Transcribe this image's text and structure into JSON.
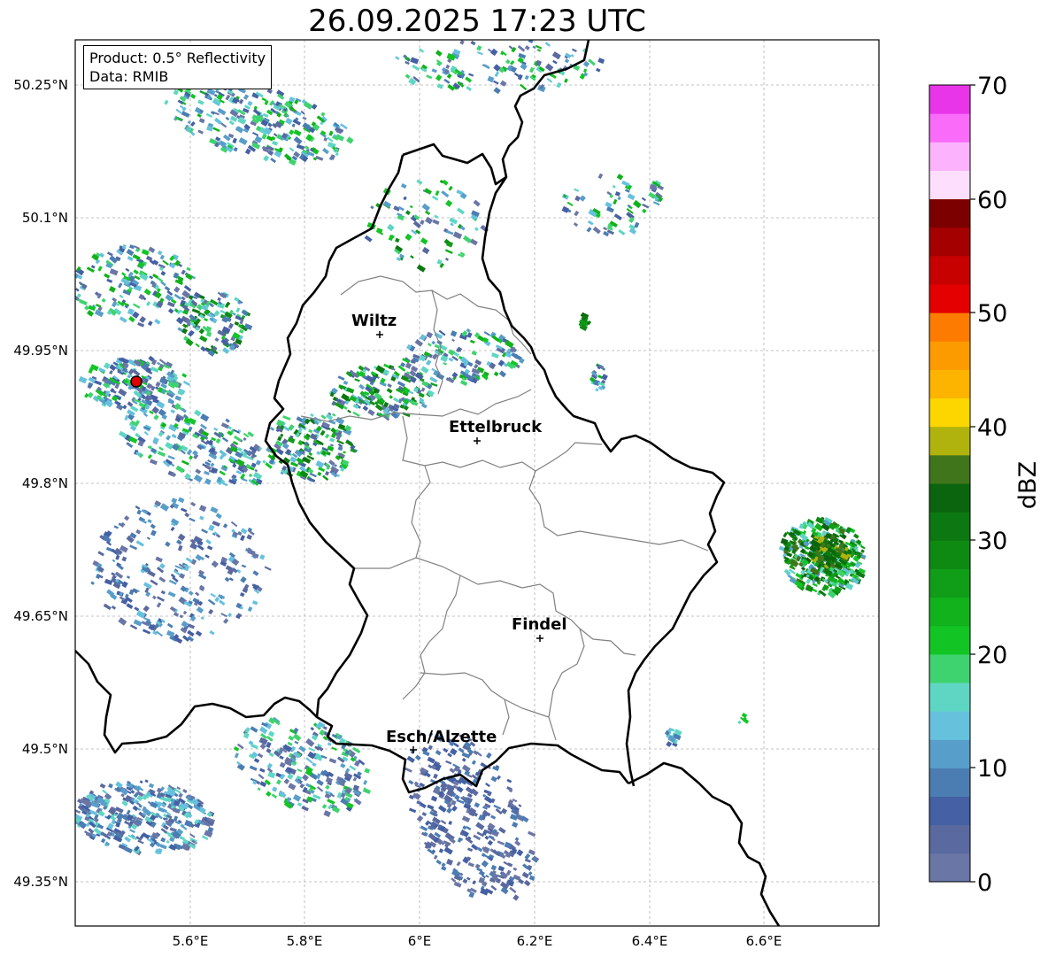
{
  "title": "26.09.2025 17:23 UTC",
  "info": {
    "product": "Product: 0.5° Reflectivity",
    "data": "Data: RMIB"
  },
  "axes": {
    "lon_ticks": [
      "5.6°E",
      "5.8°E",
      "6°E",
      "6.2°E",
      "6.4°E",
      "6.6°E"
    ],
    "lat_ticks": [
      "50.25°N",
      "50.1°N",
      "49.95°N",
      "49.8°N",
      "49.65°N",
      "49.5°N",
      "49.35°N"
    ]
  },
  "places": [
    {
      "name": "Wiltz"
    },
    {
      "name": "Ettelbruck"
    },
    {
      "name": "Findel"
    },
    {
      "name": "Esch/Alzette"
    }
  ],
  "colorbar": {
    "label": "dBZ",
    "ticks": [
      "0",
      "10",
      "20",
      "30",
      "40",
      "50",
      "60",
      "70"
    ],
    "colors": [
      "#6a76a6",
      "#5a6aa0",
      "#4560a3",
      "#4b7db2",
      "#589eca",
      "#66c1dd",
      "#5fd6c4",
      "#3ed36e",
      "#12c524",
      "#11b21b",
      "#109d17",
      "#0e8a13",
      "#0c7811",
      "#0b650e",
      "#41751b",
      "#b0b30e",
      "#fdd600",
      "#fcb400",
      "#fc9b00",
      "#fd7c00",
      "#e40000",
      "#c70000",
      "#a50000",
      "#7c0000",
      "#fddefd",
      "#fcb2fc",
      "#f96cf9",
      "#e835e8"
    ]
  }
}
